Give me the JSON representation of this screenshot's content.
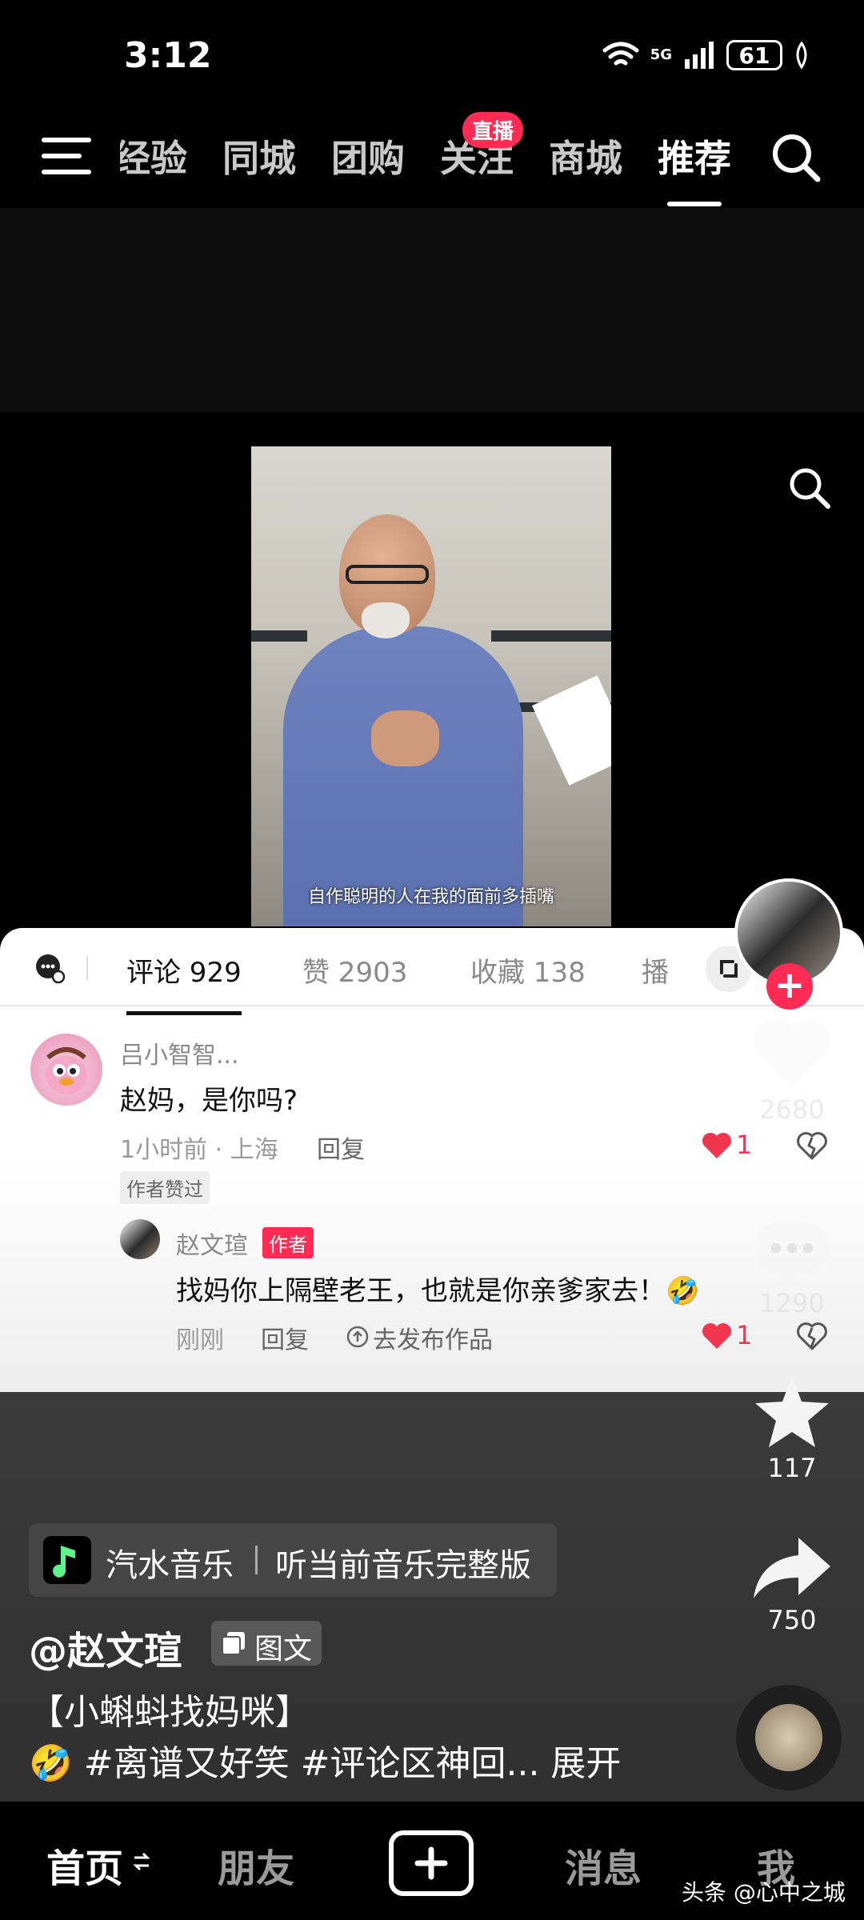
{
  "status_bar": {
    "time": "3:12",
    "battery": "61",
    "network": "5G"
  },
  "top_tabs": {
    "items": [
      "经验",
      "同城",
      "团购",
      "关注",
      "商城",
      "推荐"
    ],
    "active": "推荐",
    "live_badge": "直播"
  },
  "video": {
    "subtitle": "自作聪明的人在我的面前多插嘴"
  },
  "comment_panel": {
    "tabs": {
      "comments": "评论 929",
      "likes": "赞 2903",
      "favorites": "收藏 138",
      "more": "播"
    },
    "comments": [
      {
        "name": "吕小智智...",
        "text": "赵妈，是你吗?",
        "meta": "1小时前 · 上海",
        "reply_label": "回复",
        "liked_tag": "作者赞过",
        "likes": "1"
      }
    ],
    "reply": {
      "name": "赵文瑄",
      "author_tag": "作者",
      "text": "找妈你上隔壁老王，也就是你亲爹家去！🤣",
      "meta": "刚刚",
      "reply_label": "回复",
      "publish_label": "去发布作品",
      "likes": "1"
    }
  },
  "side": {
    "like_count": "2680",
    "comment_count": "1290",
    "favorite_count": "117",
    "share_count": "750",
    "follow_plus": "+"
  },
  "music": {
    "name": "汽水音乐",
    "cta": "听当前音乐完整版"
  },
  "post": {
    "handle": "@赵文瑄",
    "type_label": "图文",
    "title": "【小蝌蚪找妈咪】",
    "tags": "🤣 #离谱又好笑 #评论区神回... 展开"
  },
  "bottom_nav": {
    "home": "首页",
    "friends": "朋友",
    "messages": "消息",
    "me": "我"
  },
  "watermark": "头条 @心中之城",
  "colors": {
    "accent": "#fe2c55",
    "background": "#000000"
  }
}
